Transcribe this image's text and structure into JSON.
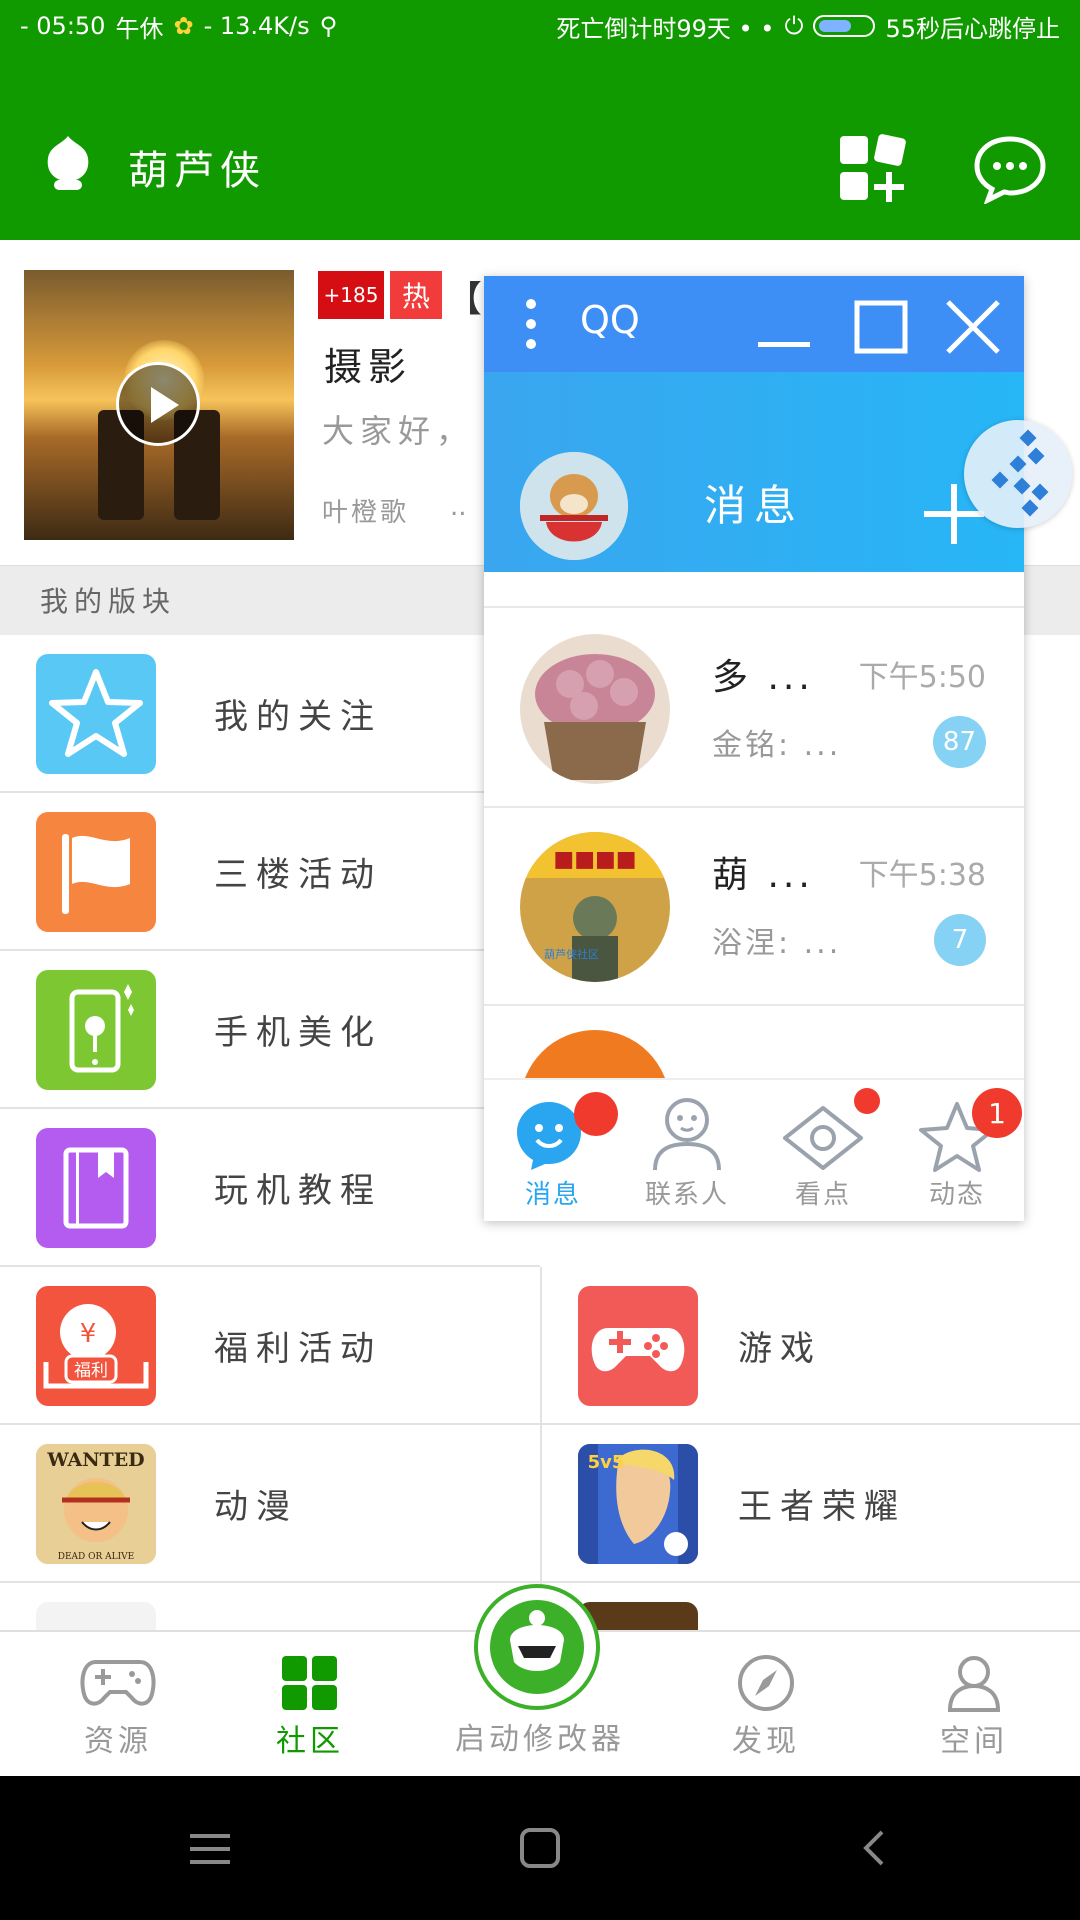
{
  "status_bar": {
    "time": "- 05:50",
    "rest": "午休",
    "net_speed": "- 13.4K/s",
    "countdown": "死亡倒计时99天 • •",
    "heartbeat": "55秒后心跳停止"
  },
  "header": {
    "title": "葫芦侠",
    "icons": [
      "app-logo-icon",
      "add-widget-icon",
      "chat-bubble-icon"
    ]
  },
  "feature": {
    "count_badge": "+185",
    "hot_badge": "热",
    "bracket": "【",
    "title": "摄影",
    "description": "大家好，",
    "author": "叶橙歌",
    "dots": ".."
  },
  "section": {
    "title": "我的版块"
  },
  "grid": {
    "left": [
      {
        "label": "我的关注",
        "icon": "star-icon",
        "color": "#5ac8f5"
      },
      {
        "label": "三楼活动",
        "icon": "flag-icon",
        "color": "#f5853f"
      },
      {
        "label": "手机美化",
        "icon": "phone-flower-icon",
        "color": "#7dc832"
      },
      {
        "label": "玩机教程",
        "icon": "book-icon",
        "color": "#b45cf0"
      },
      {
        "label": "福利活动",
        "icon": "gift-welfare-icon",
        "color": "#f2543e",
        "badge_text": "福利"
      },
      {
        "label": "动漫",
        "icon": "anime-poster-icon",
        "color": "#e7b65a",
        "poster_top": "WANTED",
        "poster_bottom": "DEAD OR ALIVE"
      }
    ],
    "right": [
      {
        "label": "游戏",
        "icon": "gamepad-icon",
        "color": "#f25a57"
      },
      {
        "label": "王者荣耀",
        "icon": "game-hero-icon",
        "color": "#2b4ea8",
        "tag": "5v5"
      }
    ]
  },
  "bottom_nav": {
    "items": [
      {
        "label": "资源",
        "icon": "gamepad-outline-icon",
        "active": false
      },
      {
        "label": "社区",
        "icon": "grid-squares-icon",
        "active": true
      },
      {
        "label": "启动修改器",
        "icon": "launcher-mascot-icon",
        "active": false
      },
      {
        "label": "发现",
        "icon": "compass-icon",
        "active": false
      },
      {
        "label": "空间",
        "icon": "person-icon",
        "active": false
      }
    ]
  },
  "qq_window": {
    "app_title": "QQ",
    "header_title": "消息",
    "conversations": [
      {
        "name": "多 ...",
        "preview": "金铭: ...",
        "time": "下午5:50",
        "unread": "87",
        "avatar": "succulent-plant-avatar"
      },
      {
        "name": "葫 ...",
        "preview": "浴涅: ...",
        "time": "下午5:38",
        "unread": "7",
        "avatar": "game-poster-avatar",
        "avatar_text": "葫芦侠社区"
      }
    ],
    "tabs": [
      {
        "label": "消息",
        "icon": "qq-message-icon",
        "active": true
      },
      {
        "label": "联系人",
        "icon": "contact-icon",
        "active": false
      },
      {
        "label": "看点",
        "icon": "eye-icon",
        "active": false
      },
      {
        "label": "动态",
        "icon": "star-outline-icon",
        "active": false,
        "badge": "1"
      }
    ]
  },
  "colors": {
    "brand_green": "#109a00",
    "qq_blue": "#3d8ff5",
    "qq_light_blue": "#86d2f4",
    "alert_red": "#f03a2e"
  }
}
